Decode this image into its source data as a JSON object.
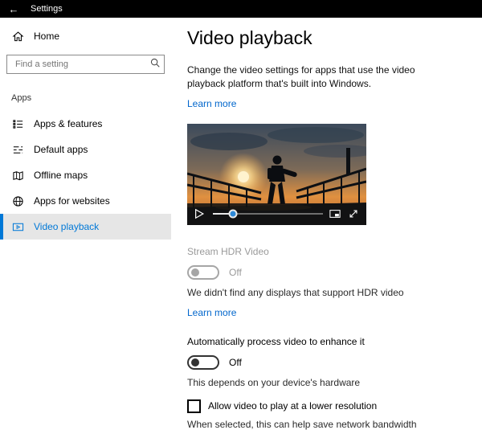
{
  "icons": {
    "back": "←"
  },
  "titlebar": {
    "title": "Settings"
  },
  "sidebar": {
    "home_label": "Home",
    "search_placeholder": "Find a setting",
    "section_label": "Apps",
    "items": [
      {
        "label": "Apps & features"
      },
      {
        "label": "Default apps"
      },
      {
        "label": "Offline maps"
      },
      {
        "label": "Apps for websites"
      },
      {
        "label": "Video playback"
      }
    ]
  },
  "main": {
    "title": "Video playback",
    "description": "Change the video settings for apps that use the video playback platform that's built into Windows.",
    "learn_more": "Learn more",
    "hdr": {
      "label": "Stream HDR Video",
      "state": "Off",
      "note": "We didn't find any displays that support HDR video",
      "learn_more": "Learn more"
    },
    "enhance": {
      "label": "Automatically process video to enhance it",
      "state": "Off",
      "note": "This depends on your device's hardware"
    },
    "low_res": {
      "label": "Allow video to play at a lower resolution",
      "note": "When selected, this can help save network bandwidth"
    }
  },
  "colors": {
    "accent": "#0078d7",
    "link": "#0066cc"
  }
}
